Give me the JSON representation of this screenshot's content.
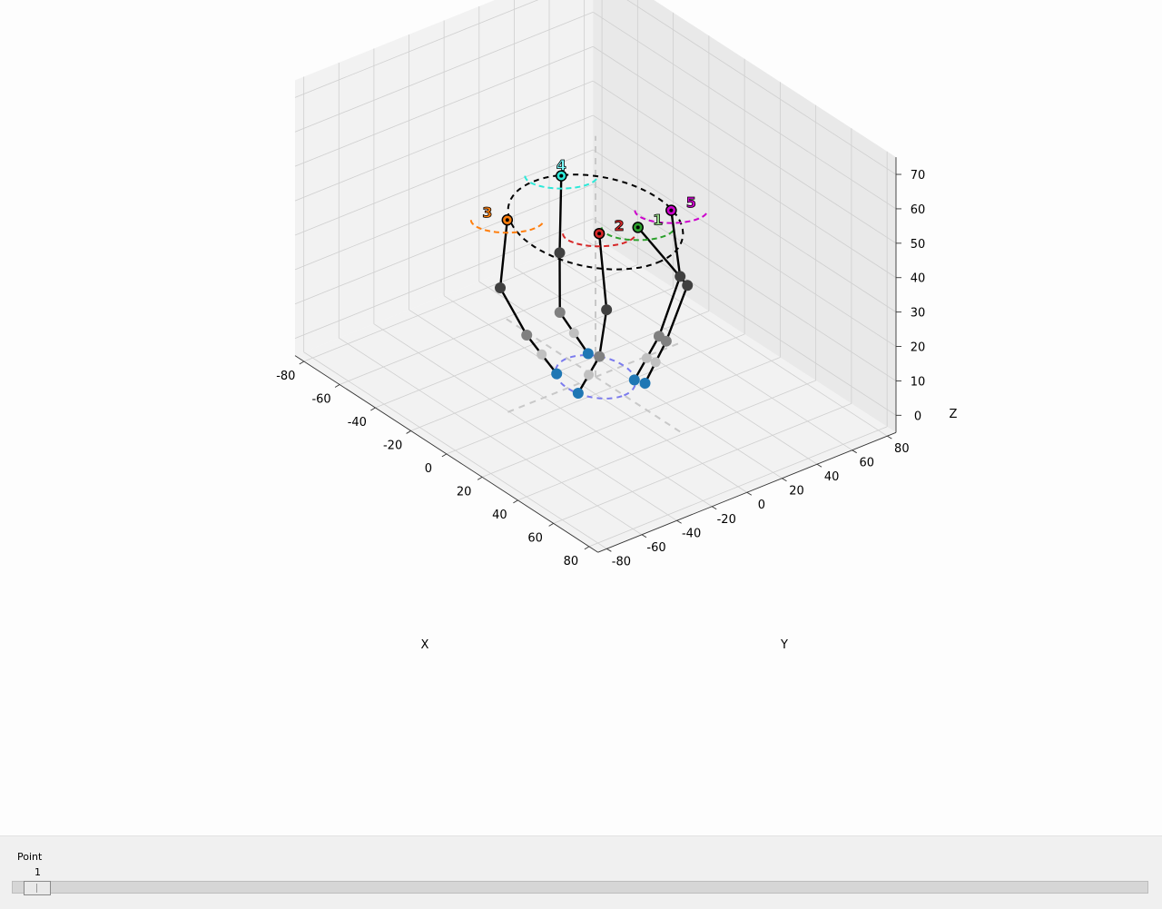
{
  "chart_data": {
    "type": "scatter",
    "subtype": "3d-skeleton",
    "xlabel": "X",
    "ylabel": "Y",
    "zlabel": "Z",
    "xlim": [
      -85,
      85
    ],
    "ylim": [
      -85,
      85
    ],
    "zlim": [
      -5,
      75
    ],
    "x_ticks": [
      -80,
      -60,
      -40,
      -20,
      0,
      20,
      40,
      60,
      80
    ],
    "y_ticks": [
      -80,
      -60,
      -40,
      -20,
      0,
      20,
      40,
      60,
      80
    ],
    "z_ticks": [
      0,
      10,
      20,
      30,
      40,
      50,
      60,
      70
    ],
    "grid": true,
    "colors": {
      "limb": "#000000",
      "foot": "#1f77b4",
      "joint_dark": "#404040",
      "joint_mid": "#808080",
      "joint_light": "#c0c0c0",
      "ring_top": "#000000",
      "ring_bottom": "#7b7bee",
      "guide": "#c8c8c8"
    },
    "ring_top": {
      "z": 45,
      "r": 35
    },
    "ring_bottom": {
      "z": 0,
      "r": 16
    },
    "legs": [
      {
        "label": "1",
        "color": "#2ca02c",
        "label_color": "#98df8a",
        "tip": [
          12,
          12,
          45
        ],
        "knee": [
          26,
          26,
          30
        ],
        "ankle": [
          20,
          20,
          13
        ],
        "foot": [
          14,
          14,
          0
        ]
      },
      {
        "label": "2",
        "color": "#d62728",
        "label_color": "#d62728",
        "tip": [
          7,
          -5,
          45
        ],
        "knee": [
          18,
          -12,
          28
        ],
        "ankle": [
          12,
          -10,
          12
        ],
        "foot": [
          5,
          -15,
          0
        ]
      },
      {
        "label": "3",
        "color": "#ff7f0e",
        "label_color": "#ff7f0e",
        "tip": [
          -20,
          -30,
          45
        ],
        "knee": [
          -22,
          -32,
          25
        ],
        "ankle": [
          -15,
          -24,
          12
        ],
        "foot": [
          -10,
          -12,
          0
        ]
      },
      {
        "label": "4",
        "color": "#2ee8d8",
        "label_color": "#7fffff",
        "tip": [
          -32,
          13,
          45
        ],
        "knee": [
          -28,
          8,
          25
        ],
        "ankle": [
          -20,
          0,
          12
        ],
        "foot": [
          -14,
          10,
          0
        ]
      },
      {
        "label": "5",
        "color": "#cc00cc",
        "label_color": "#cc00cc",
        "tip": [
          10,
          33,
          45
        ],
        "knee": [
          16,
          32,
          28
        ],
        "ankle": [
          14,
          22,
          12
        ],
        "foot": [
          10,
          12,
          0
        ]
      }
    ]
  },
  "slider": {
    "label": "Point",
    "value": "1",
    "fraction": 0.0
  }
}
